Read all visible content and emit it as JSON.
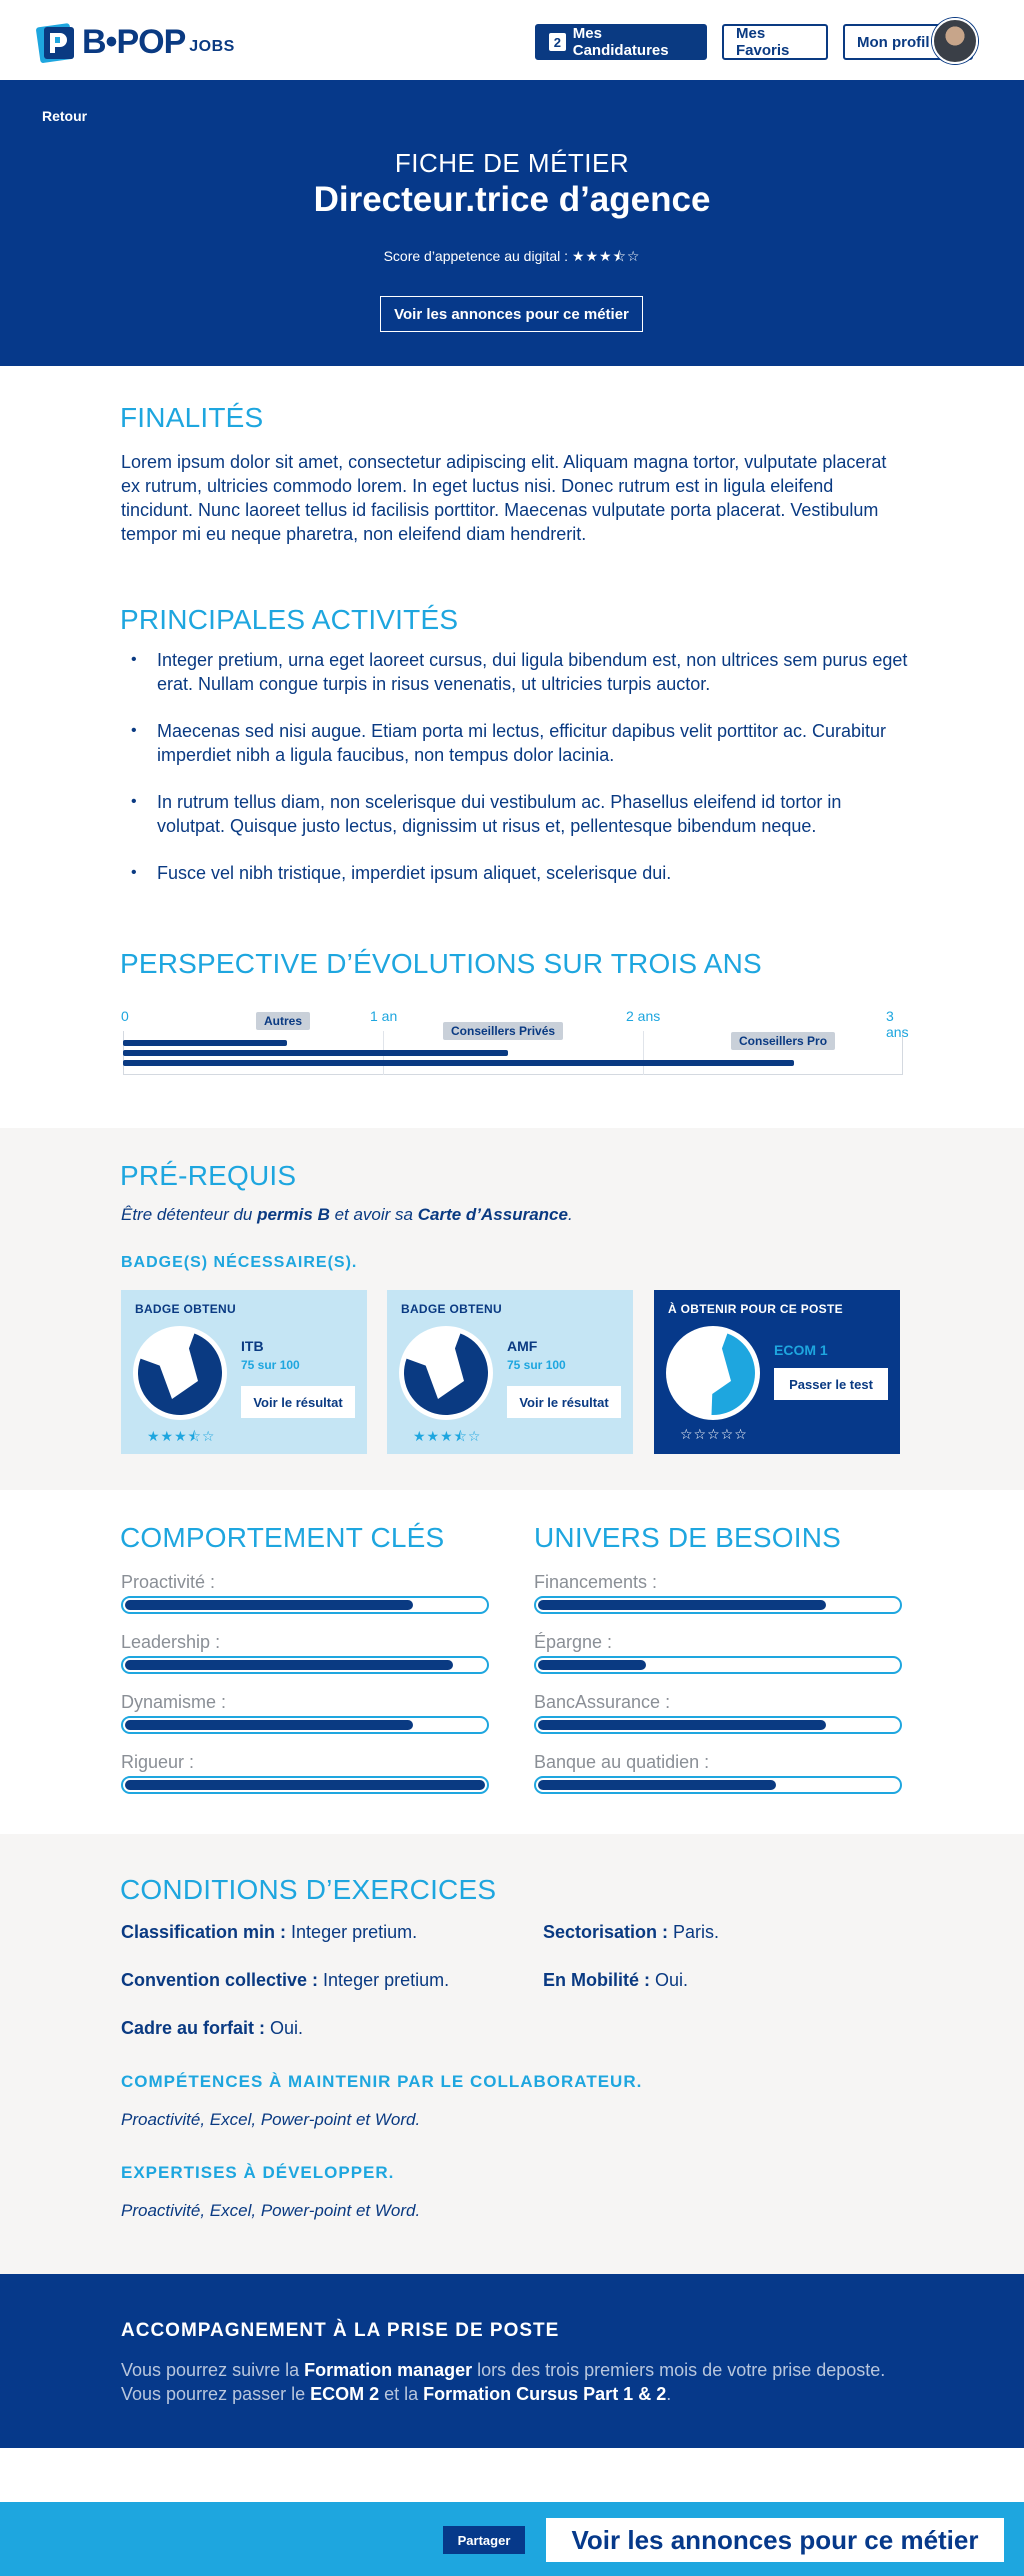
{
  "header": {
    "logo_text": "B•POP",
    "logo_sub": "JOBS",
    "applications_count": "2",
    "applications_label": "Mes Candidatures",
    "favorites_label": "Mes Favoris",
    "profile_label": "Mon profil"
  },
  "hero": {
    "back": "Retour",
    "kicker": "FICHE DE MÉTIER",
    "title": "Directeur.trice d’agence",
    "score_label": "Score d’appetence au digital :",
    "score_stars": "★★★⯪☆",
    "score_value": 3.5,
    "cta": "Voir les annonces pour ce métier"
  },
  "finalites": {
    "title": "FINALITÉS",
    "text": "Lorem ipsum dolor sit amet, consectetur adipiscing elit. Aliquam magna tortor, vulputate placerat ex rutrum, ultricies commodo lorem. In eget luctus nisi. Donec rutrum est in ligula eleifend tincidunt. Nunc laoreet tellus id facilisis porttitor. Maecenas vulputate porta placerat. Vestibulum tempor mi eu neque pharetra, non eleifend diam hendrerit."
  },
  "activites": {
    "title": "PRINCIPALES ACTIVITÉS",
    "items": [
      "Integer pretium, urna eget laoreet cursus, dui ligula bibendum est, non ultrices sem purus eget erat. Nullam congue turpis in risus venenatis, ut ultricies turpis auctor.",
      "Maecenas sed nisi augue. Etiam porta mi lectus, efficitur dapibus velit porttitor ac. Curabitur imperdiet nibh a ligula faucibus, non tempus dolor lacinia.",
      "In rutrum tellus diam, non scelerisque dui vestibulum ac. Phasellus eleifend id tortor in volutpat. Quisque justo lectus, dignissim ut risus et, pellentesque bibendum neque.",
      "Fusce vel nibh tristique, imperdiet ipsum aliquet, scelerisque dui."
    ]
  },
  "evolution": {
    "title": "PERSPECTIVE D’ÉVOLUTIONS SUR TROIS ANS",
    "ticks": [
      "0",
      "1 an",
      "2 ans",
      "3 ans"
    ],
    "tracks": [
      {
        "label": "Autres",
        "years": 0.63
      },
      {
        "label": "Conseillers Privés",
        "years": 1.48
      },
      {
        "label": "Conseillers Pro",
        "years": 2.58
      }
    ]
  },
  "prerequis": {
    "title": "PRÉ-REQUIS",
    "text_1": "Être détenteur du ",
    "bold_1": "permis B",
    "text_2": " et avoir sa ",
    "bold_2": "Carte d’Assurance",
    "text_3": ".",
    "badges_title": "BADGE(S) NÉCESSAIRE(S).",
    "badges": [
      {
        "kicker": "BADGE OBTENU",
        "name": "ITB",
        "score": "75 sur 100",
        "button": "Voir le résultat",
        "stars": "★★★⯪☆",
        "fraction": 0.75
      },
      {
        "kicker": "BADGE OBTENU",
        "name": "AMF",
        "score": "75 sur 100",
        "button": "Voir le résultat",
        "stars": "★★★⯪☆",
        "fraction": 0.75
      },
      {
        "kicker": "À OBTENIR POUR CE POSTE",
        "name": "ECOM 1",
        "score": "",
        "button": "Passer le test",
        "stars": "☆☆☆☆☆",
        "fraction": 0.45
      }
    ]
  },
  "comportement": {
    "title": "COMPORTEMENT CLÉS",
    "items": [
      {
        "label": "Proactivité :",
        "value": 0.8
      },
      {
        "label": "Leadership :",
        "value": 0.91
      },
      {
        "label": "Dynamisme :",
        "value": 0.8
      },
      {
        "label": "Rigueur :",
        "value": 1.0
      }
    ]
  },
  "univers": {
    "title": "UNIVERS DE BESOINS",
    "items": [
      {
        "label": "Financements :",
        "value": 0.8
      },
      {
        "label": "Épargne :",
        "value": 0.3
      },
      {
        "label": "BancAssurance :",
        "value": 0.8
      },
      {
        "label": "Banque au quatidien :",
        "value": 0.66
      }
    ]
  },
  "conditions": {
    "title": "CONDITIONS D’EXERCICES",
    "classification_label": "Classification min :",
    "classification_value": " Integer pretium.",
    "sectorisation_label": "Sectorisation :",
    "sectorisation_value": " Paris.",
    "convention_label": "Convention collective :",
    "convention_value": " Integer pretium.",
    "mobilite_label": "En Mobilité :",
    "mobilite_value": " Oui.",
    "forfait_label": "Cadre au forfait :",
    "forfait_value": " Oui.",
    "competences_title": "COMPÉTENCES À MAINTENIR PAR LE COLLABORATEUR.",
    "competences_text": "Proactivité, Excel, Power-point et Word.",
    "expertises_title": "EXPERTISES À DÉVELOPPER.",
    "expertises_text": "Proactivité, Excel, Power-point et Word."
  },
  "accompagnement": {
    "title": "ACCOMPAGNEMENT À LA PRISE DE POSTE",
    "t1": "Vous pourrez suivre la ",
    "b1": "Formation manager",
    "t2": " lors des trois premiers mois de votre prise deposte. Vous pourrez passer le ",
    "b2": "ECOM 2",
    "t3": " et la ",
    "b3": "Formation Cursus Part 1 & 2",
    "t4": "."
  },
  "footer": {
    "share": "Partager",
    "cta": "Voir les annonces pour ce métier"
  },
  "colors": {
    "navy": "#06398a",
    "cyan": "#1ea6df",
    "light_blue": "#c5e5f4",
    "grey_band": "#f6f5f4"
  }
}
